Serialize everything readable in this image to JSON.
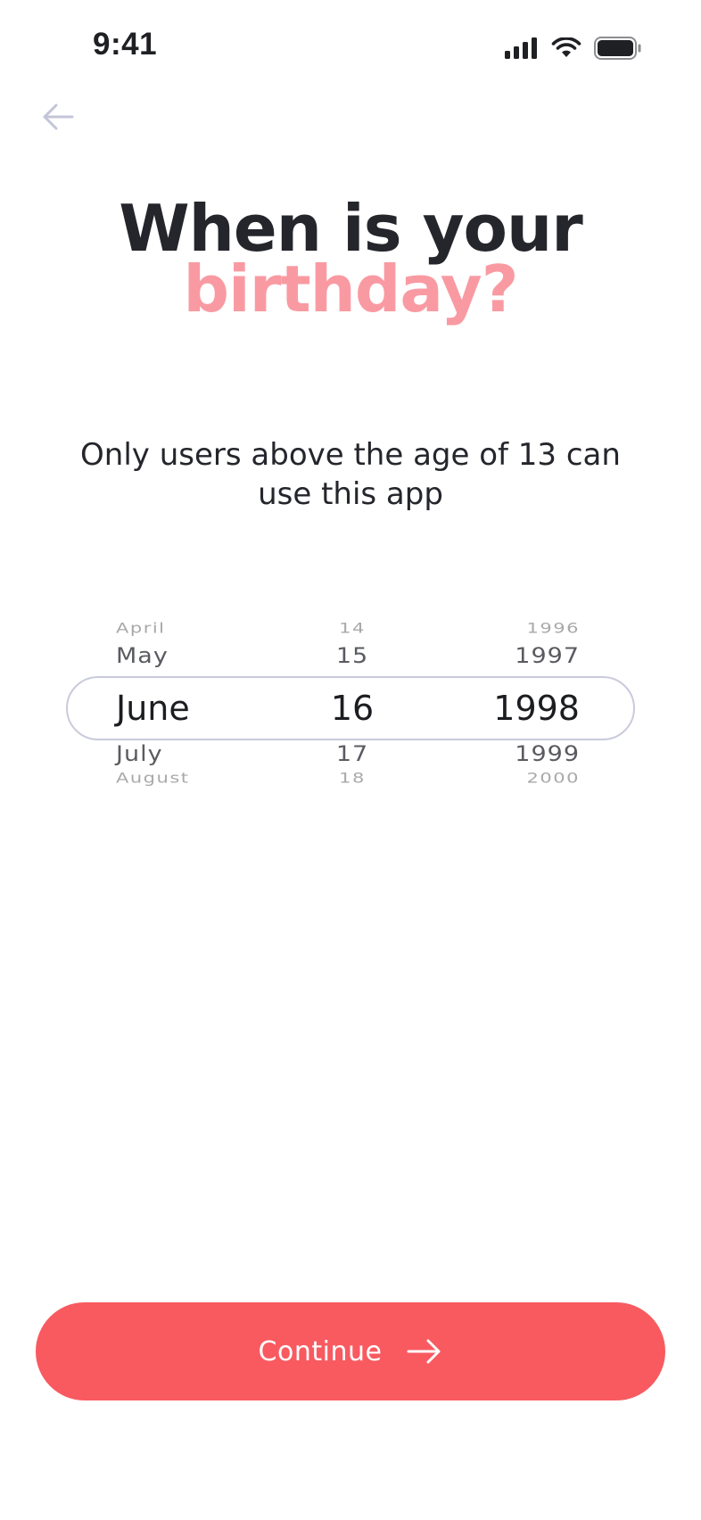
{
  "status_bar": {
    "time": "9:41",
    "icons": [
      "cellular-signal-icon",
      "wifi-icon",
      "battery-icon"
    ]
  },
  "header": {
    "back_icon": "arrow-left-icon"
  },
  "title": {
    "line1": "When is your",
    "line2": "birthday?",
    "line1_color": "#24262c",
    "line2_color": "#f99aa2"
  },
  "subtitle": "Only users above the age of 13 can use this app",
  "picker": {
    "months": [
      "April",
      "May",
      "June",
      "July",
      "August"
    ],
    "days": [
      "14",
      "15",
      "16",
      "17",
      "18"
    ],
    "years": [
      "1996",
      "1997",
      "1998",
      "1999",
      "2000"
    ],
    "selected": {
      "month": "June",
      "day": "16",
      "year": "1998"
    }
  },
  "continue_button": {
    "label": "Continue",
    "icon": "arrow-right-icon",
    "color": "#f85a60"
  }
}
